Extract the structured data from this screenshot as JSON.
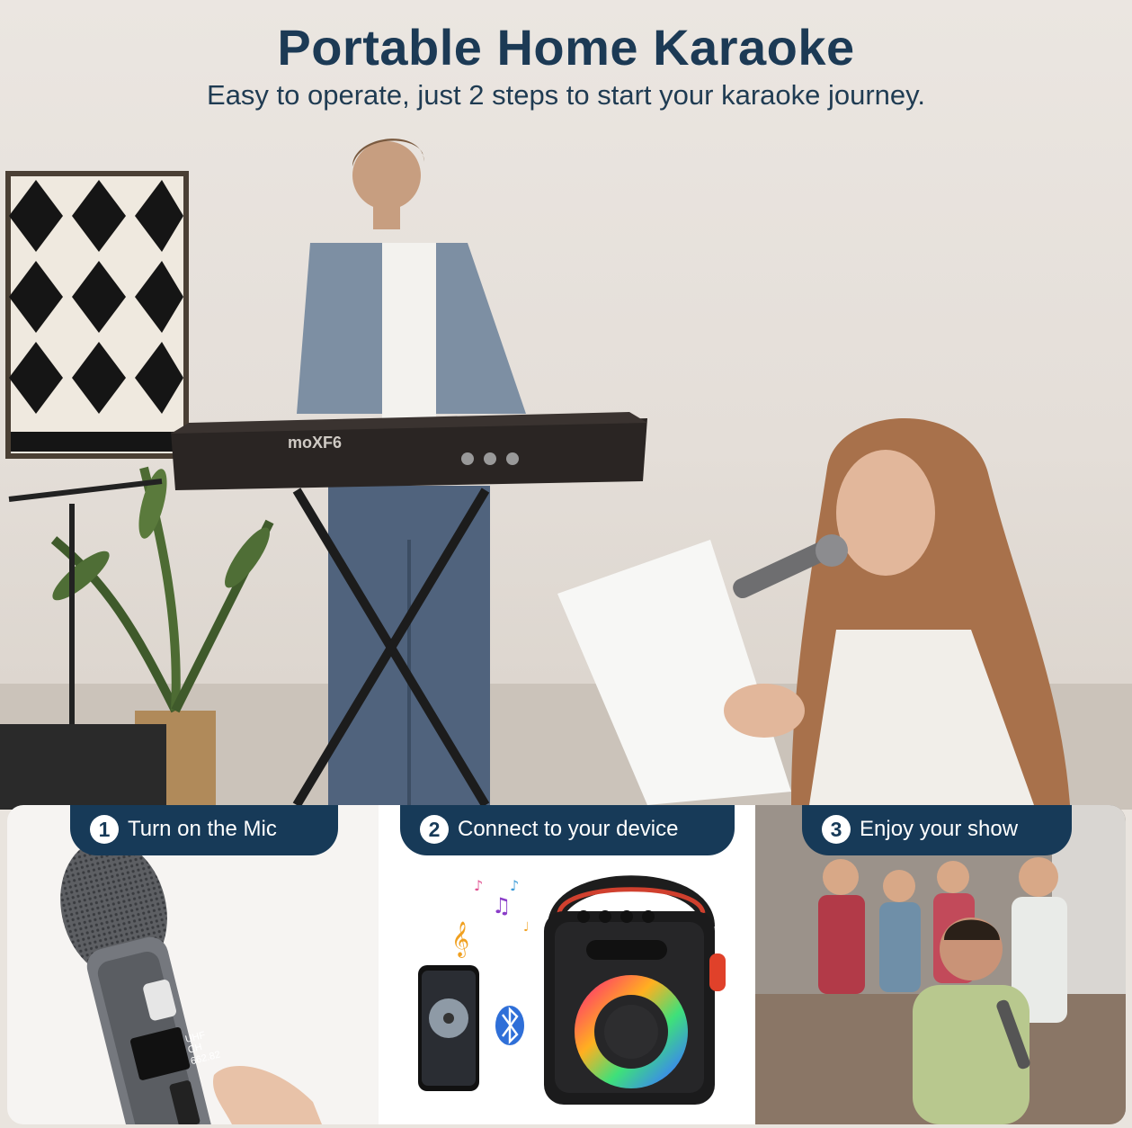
{
  "header": {
    "title": "Portable Home Karaoke",
    "subtitle": "Easy to operate, just 2 steps to start your karaoke journey."
  },
  "scene": {
    "keyboard_brand": "moXF6"
  },
  "steps": [
    {
      "number": "1",
      "label": "Turn on the Mic"
    },
    {
      "number": "2",
      "label": "Connect to your device"
    },
    {
      "number": "3",
      "label": "Enjoy your show"
    }
  ],
  "mic_display": {
    "band": "UHF",
    "channel": "CH",
    "frequency": "662.82"
  },
  "colors": {
    "title": "#1c3a55",
    "step_badge": "#173a58",
    "bluetooth": "#2f6fd8"
  },
  "icons": [
    "bluetooth-icon",
    "music-notes-icon",
    "treble-clef-icon"
  ]
}
